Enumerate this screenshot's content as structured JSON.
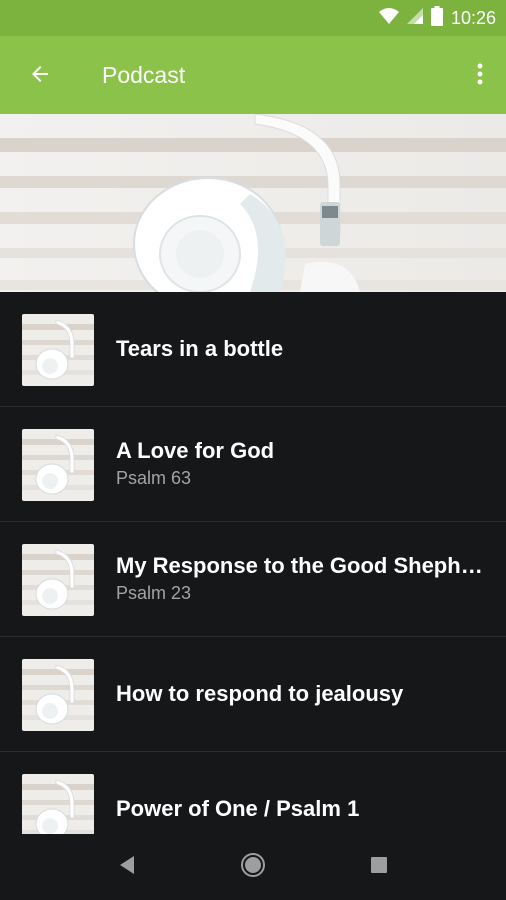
{
  "status_bar": {
    "time": "10:26",
    "icons": [
      "wifi-icon",
      "signal-icon",
      "battery-icon"
    ]
  },
  "app_bar": {
    "title": "Podcast",
    "back_icon": "arrow-left-icon",
    "menu_icon": "more-vert-icon",
    "color": "#8bc34a"
  },
  "hero": {
    "image": "white-headphones-photo"
  },
  "episodes": [
    {
      "title": "Tears in a bottle",
      "subtitle": ""
    },
    {
      "title": "A Love for God",
      "subtitle": "Psalm 63"
    },
    {
      "title": "My Response to the Good Shepherd",
      "subtitle": "Psalm 23"
    },
    {
      "title": "How to respond to jealousy",
      "subtitle": ""
    },
    {
      "title": "Power of One / Psalm 1",
      "subtitle": ""
    }
  ],
  "nav_bar": {
    "icons": [
      "back-triangle-icon",
      "home-circle-icon",
      "recents-square-icon"
    ]
  }
}
